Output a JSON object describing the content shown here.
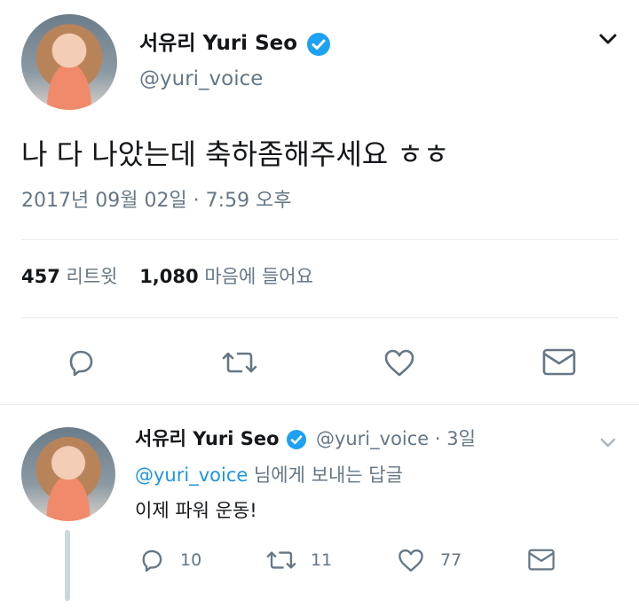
{
  "tweet": {
    "display_name": "서유리 Yuri Seo",
    "handle": "@yuri_voice",
    "text": "나 다 나았는데 축하좀해주세요 ㅎㅎ",
    "timestamp": "2017년 09월 02일 · 7:59 오후",
    "retweet_count": "457",
    "retweet_label": "리트윗",
    "like_count": "1,080",
    "like_label": "마음에 들어요"
  },
  "reply": {
    "display_name": "서유리 Yuri Seo",
    "handle": "@yuri_voice",
    "age": "· 3일",
    "replying_to_handle": "@yuri_voice",
    "replying_to_suffix": "님에게 보내는 답글",
    "text": "이제 파워 운동!",
    "reply_count": "10",
    "retweet_count": "11",
    "like_count": "77"
  },
  "colors": {
    "verified": "#1da1f2",
    "link": "#1b95e0",
    "secondary_text": "#657786",
    "icon": "#657786",
    "divider": "#e6ecf0"
  },
  "icons": [
    "chevron-down-icon",
    "verified-badge-icon",
    "reply-icon",
    "retweet-icon",
    "like-icon",
    "message-icon"
  ]
}
